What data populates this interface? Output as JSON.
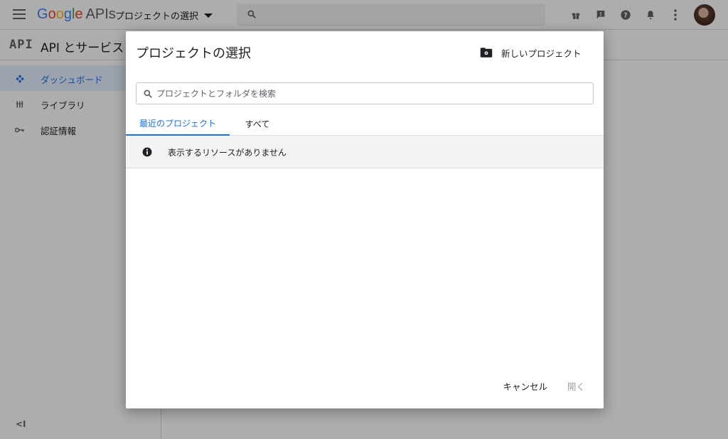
{
  "topbar": {
    "brand": "Google",
    "brand_suffix": "APIs",
    "project_picker_label": "プロジェクトの選択",
    "colors": {
      "g_blue": "#4285f4",
      "g_red": "#ea4335",
      "g_yellow": "#fbbc05",
      "g_green": "#34a853"
    },
    "icons": [
      "menu-icon",
      "search-icon",
      "gift-icon",
      "feedback-icon",
      "help-icon",
      "notifications-icon",
      "more-vert-icon"
    ]
  },
  "subbar": {
    "api_mark": "API",
    "title": "API とサービス"
  },
  "sidebar": {
    "items": [
      {
        "label": "ダッシュボード",
        "icon": "dashboard-icon",
        "active": true
      },
      {
        "label": "ライブラリ",
        "icon": "library-icon",
        "active": false
      },
      {
        "label": "認証情報",
        "icon": "key-icon",
        "active": false
      }
    ],
    "collapse_label": "<I"
  },
  "dialog": {
    "title": "プロジェクトの選択",
    "new_project_label": "新しいプロジェクト",
    "search_placeholder": "プロジェクトとフォルダを検索",
    "search_value": "",
    "tabs": [
      {
        "label": "最近のプロジェクト",
        "active": true
      },
      {
        "label": "すべて",
        "active": false
      }
    ],
    "empty_message": "表示するリソースがありません",
    "cancel_label": "キャンセル",
    "open_label": "開く",
    "accent_color": "#1a73e8"
  }
}
